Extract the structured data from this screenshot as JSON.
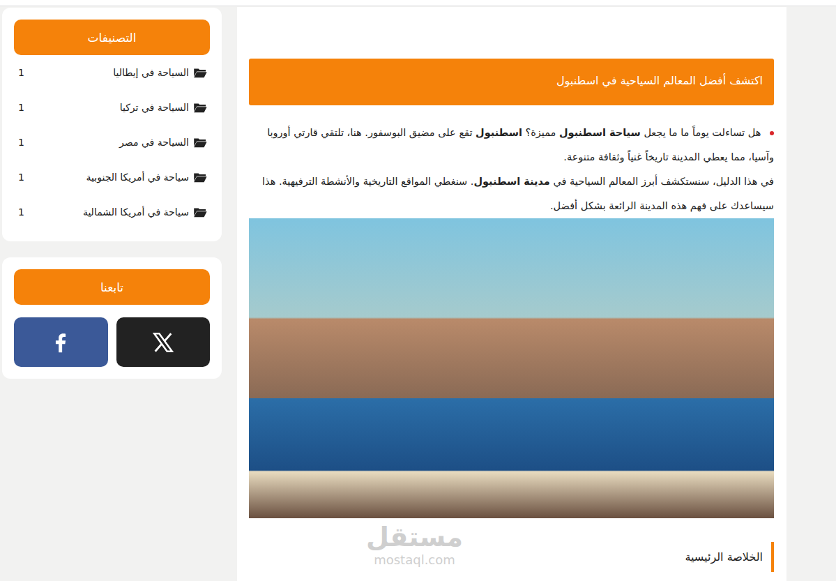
{
  "sidebar": {
    "categories": {
      "title": "التصنيفات",
      "items": [
        {
          "label": "السياحة في إيطاليا",
          "count": "1"
        },
        {
          "label": "السياحة في تركيا",
          "count": "1"
        },
        {
          "label": "السياحة في مصر",
          "count": "1"
        },
        {
          "label": "سياحة في أمريكا الجنوبية",
          "count": "1"
        },
        {
          "label": "سياحة في أمريكا الشمالية",
          "count": "1"
        }
      ]
    },
    "follow": {
      "title": "تابعنا",
      "buttons": [
        {
          "kind": "x"
        },
        {
          "kind": "facebook"
        }
      ]
    }
  },
  "article": {
    "title": "اكتشف أفضل المعالم السياحية في اسطنبول",
    "paragraphs": [
      {
        "bullet": true,
        "segments": [
          {
            "text": "هل تساءلت يوماً ما ما يجعل ",
            "bold": false
          },
          {
            "text": "سياحة اسطنبول",
            "bold": true
          },
          {
            "text": " مميزة؟ ",
            "bold": false
          },
          {
            "text": "اسطنبول",
            "bold": true
          },
          {
            "text": " تقع على مضيق البوسفور. هنا، تلتقي قارتي أوروبا وآسيا، مما يعطي المدينة تاريخاً غنياً وثقافة متنوعة.",
            "bold": false
          }
        ]
      },
      {
        "bullet": false,
        "segments": [
          {
            "text": "في هذا الدليل، سنستكشف أبرز المعالم السياحية في ",
            "bold": false
          },
          {
            "text": "مدينة اسطنبول",
            "bold": true
          },
          {
            "text": ". سنغطي المواقع التاريخية والأنشطة الترفيهية. هذا سيساعدك على فهم هذه المدينة الرائعة بشكل أفضل.",
            "bold": false
          }
        ]
      }
    ],
    "section_heading": "الخلاصة الرئيسية"
  },
  "watermark": {
    "logo": "مستقل",
    "site": "mostaql.com"
  }
}
